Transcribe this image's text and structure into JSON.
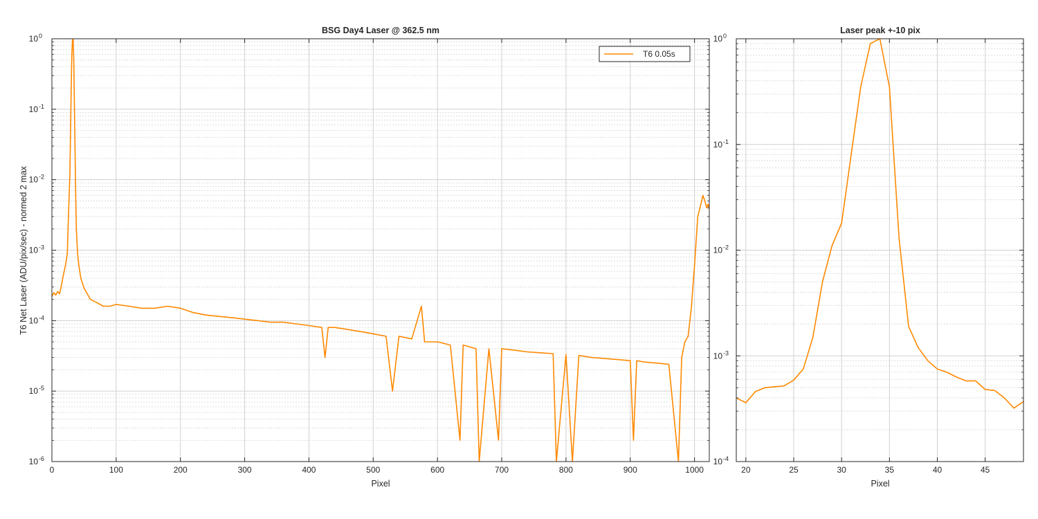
{
  "chart_data": [
    {
      "type": "line",
      "title": "BSG  Day4 Laser @ 362.5 nm",
      "xlabel": "Pixel",
      "ylabel": "T6 Net Laser (ADU/pix/sec) - normed 2 max",
      "xlim": [
        0,
        1023
      ],
      "ylim": [
        1e-06,
        1
      ],
      "yscale": "log",
      "grid": true,
      "minor_grid": true,
      "x_ticks": [
        0,
        100,
        200,
        300,
        400,
        500,
        600,
        700,
        800,
        900,
        1000
      ],
      "y_ticks": [
        1e-06,
        1e-05,
        0.0001,
        0.001,
        0.01,
        0.1,
        1
      ],
      "y_tick_labels": [
        [
          "10",
          "-6"
        ],
        [
          "10",
          "-5"
        ],
        [
          "10",
          "-4"
        ],
        [
          "10",
          "-3"
        ],
        [
          "10",
          "-2"
        ],
        [
          "10",
          "-1"
        ],
        [
          "10",
          "0"
        ]
      ],
      "legend": {
        "position": "top-right",
        "entries": [
          "T6 0.05s"
        ]
      },
      "series": [
        {
          "name": "T6 0.05s",
          "color": "#ff8800",
          "x": [
            0,
            3,
            6,
            9,
            12,
            15,
            18,
            21,
            24,
            26,
            28,
            30,
            31,
            32,
            33,
            34,
            35,
            36,
            37,
            38,
            40,
            42,
            45,
            50,
            55,
            60,
            70,
            80,
            90,
            100,
            120,
            140,
            160,
            180,
            200,
            220,
            240,
            260,
            280,
            300,
            320,
            340,
            360,
            380,
            400,
            420,
            425,
            430,
            440,
            460,
            480,
            500,
            520,
            530,
            540,
            560,
            575,
            580,
            600,
            620,
            635,
            640,
            660,
            665,
            680,
            695,
            700,
            720,
            740,
            760,
            780,
            785,
            800,
            810,
            820,
            840,
            860,
            880,
            900,
            905,
            910,
            920,
            940,
            960,
            975,
            980,
            985,
            990,
            995,
            1000,
            1005,
            1010,
            1013,
            1016,
            1019,
            1021,
            1023
          ],
          "y": [
            0.00022,
            0.00025,
            0.00023,
            0.00026,
            0.00024,
            0.00032,
            0.00045,
            0.0006,
            0.0009,
            0.0035,
            0.012,
            0.2,
            0.6,
            0.95,
            1.0,
            0.5,
            0.12,
            0.03,
            0.006,
            0.002,
            0.0009,
            0.0006,
            0.0004,
            0.00029,
            0.00024,
            0.0002,
            0.00018,
            0.00016,
            0.00016,
            0.00017,
            0.00016,
            0.00015,
            0.00015,
            0.00016,
            0.00015,
            0.00013,
            0.00012,
            0.000115,
            0.00011,
            0.000105,
            0.0001,
            9.5e-05,
            9.5e-05,
            9e-05,
            8.5e-05,
            8e-05,
            3e-05,
            8e-05,
            8e-05,
            7.5e-05,
            7e-05,
            6.5e-05,
            6e-05,
            1e-05,
            6e-05,
            5.5e-05,
            0.00016,
            5e-05,
            5e-05,
            4.5e-05,
            2e-06,
            4.5e-05,
            4e-05,
            1e-06,
            4e-05,
            2e-06,
            4e-05,
            3.8e-05,
            3.6e-05,
            3.5e-05,
            3.4e-05,
            1e-06,
            3.3e-05,
            1e-06,
            3.2e-05,
            3e-05,
            2.9e-05,
            2.8e-05,
            2.7e-05,
            2e-06,
            2.7e-05,
            2.6e-05,
            2.5e-05,
            2.4e-05,
            1e-06,
            3e-05,
            5e-05,
            6e-05,
            0.00015,
            0.0006,
            0.003,
            0.0045,
            0.006,
            0.005,
            0.004,
            0.0045,
            0.0038
          ]
        }
      ]
    },
    {
      "type": "line",
      "title": "Laser peak +-10 pix",
      "xlabel": "Pixel",
      "ylabel": "",
      "xlim": [
        19,
        49
      ],
      "ylim": [
        0.0001,
        1
      ],
      "yscale": "log",
      "grid": true,
      "minor_grid": true,
      "x_ticks": [
        20,
        25,
        30,
        35,
        40,
        45
      ],
      "y_ticks": [
        0.0001,
        0.001,
        0.01,
        0.1,
        1
      ],
      "y_tick_labels": [
        [
          "10",
          "-4"
        ],
        [
          "10",
          "-3"
        ],
        [
          "10",
          "-2"
        ],
        [
          "10",
          "-1"
        ],
        [
          "10",
          "0"
        ]
      ],
      "series": [
        {
          "color": "#ff8800",
          "x": [
            19,
            20,
            21,
            22,
            23,
            24,
            25,
            26,
            27,
            28,
            29,
            30,
            31,
            32,
            33,
            34,
            35,
            36,
            37,
            38,
            39,
            40,
            41,
            42,
            43,
            44,
            45,
            46,
            47,
            48,
            49
          ],
          "y": [
            0.0004,
            0.00036,
            0.00046,
            0.0005,
            0.00051,
            0.00052,
            0.00059,
            0.00075,
            0.0015,
            0.005,
            0.011,
            0.018,
            0.08,
            0.35,
            0.9,
            1.0,
            0.35,
            0.013,
            0.0019,
            0.0012,
            0.0009,
            0.00075,
            0.0007,
            0.00063,
            0.00058,
            0.00058,
            0.00048,
            0.00047,
            0.0004,
            0.00032,
            0.00037
          ]
        }
      ]
    }
  ]
}
